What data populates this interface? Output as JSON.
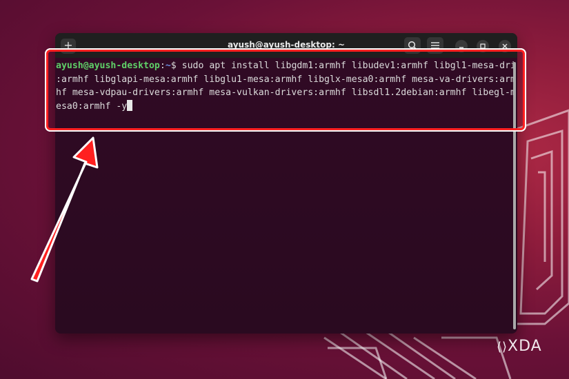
{
  "window": {
    "title": "ayush@ayush-desktop: ~",
    "new_tab_glyph": "+",
    "controls": [
      "search-icon",
      "menu-icon",
      "minimize-icon",
      "maximize-icon",
      "close-icon"
    ]
  },
  "terminal": {
    "prompt_user": "ayush@ayush-desktop",
    "prompt_sep": ":",
    "prompt_path": "~",
    "prompt_symbol": "$ ",
    "line1": "sudo apt install libgdm1:armhf libudev1:armhf libgl1-mesa-dri",
    "line2": ":armhf libglapi-mesa:armhf libglu1-mesa:armhf libglx-mesa0:armhf mesa-va-drivers:arm",
    "line3": "hf mesa-vdpau-drivers:armhf mesa-vulkan-drivers:armhf libsdl1.2debian:armhf libegl-m",
    "line4": "esa0:armhf -y"
  },
  "watermark": {
    "text": "XDA",
    "mark": "⟨⟩"
  },
  "colors": {
    "terminal_bg": "#300a24",
    "prompt_user": "#5fd068",
    "prompt_path": "#6c8de0",
    "highlight": "#ff2020"
  }
}
